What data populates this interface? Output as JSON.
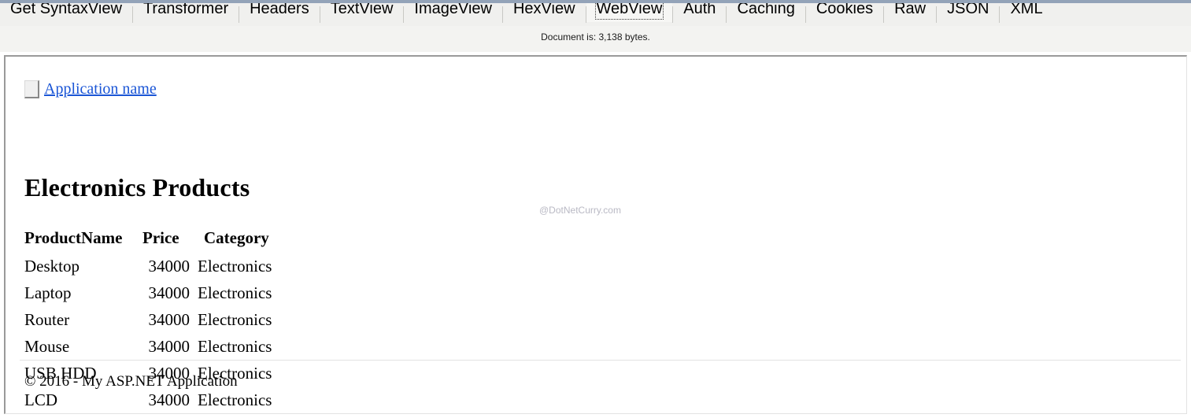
{
  "inspector": {
    "tabs": [
      {
        "label": "Get SyntaxView",
        "selected": false
      },
      {
        "label": "Transformer",
        "selected": false
      },
      {
        "label": "Headers",
        "selected": false
      },
      {
        "label": "TextView",
        "selected": false
      },
      {
        "label": "ImageView",
        "selected": false
      },
      {
        "label": "HexView",
        "selected": false
      },
      {
        "label": "WebView",
        "selected": true
      },
      {
        "label": "Auth",
        "selected": false
      },
      {
        "label": "Caching",
        "selected": false
      },
      {
        "label": "Cookies",
        "selected": false
      },
      {
        "label": "Raw",
        "selected": false
      },
      {
        "label": "JSON",
        "selected": false
      },
      {
        "label": "XML",
        "selected": false
      }
    ],
    "status": "Document is: 3,138 bytes.",
    "document_bytes": "3,138"
  },
  "page": {
    "brand": {
      "link_text": "Application name",
      "icon": "broken-image-icon",
      "link_color": "#1a55d6"
    },
    "heading": "Electronics Products",
    "table": {
      "columns": [
        "ProductName",
        "Price",
        "Category"
      ],
      "rows": [
        {
          "name": "Desktop",
          "price": "34000",
          "category": "Electronics"
        },
        {
          "name": "Laptop",
          "price": "34000",
          "category": "Electronics"
        },
        {
          "name": "Router",
          "price": "34000",
          "category": "Electronics"
        },
        {
          "name": "Mouse",
          "price": "34000",
          "category": "Electronics"
        },
        {
          "name": "USB HDD",
          "price": "34000",
          "category": "Electronics"
        },
        {
          "name": "LCD",
          "price": "34000",
          "category": "Electronics"
        }
      ]
    },
    "watermark": "@DotNetCurry.com",
    "footer": "© 2016 - My ASP.NET Application"
  }
}
